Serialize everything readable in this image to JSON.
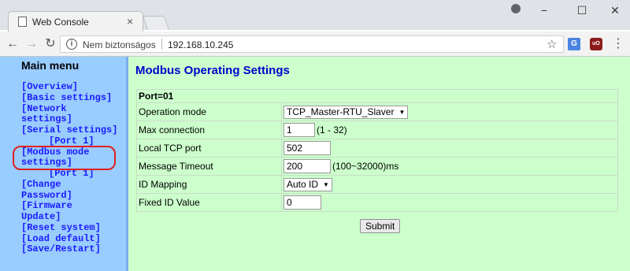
{
  "browser": {
    "tab_title": "Web Console",
    "tab_close": "×",
    "window_controls": [
      "−",
      "☐",
      "✕"
    ],
    "nav": {
      "back": "←",
      "forward": "→",
      "reload": "↻"
    },
    "security_label": "Nem biztonságos",
    "url": "192.168.10.245",
    "extensions": {
      "translate": "G",
      "ublock": "uO"
    },
    "menu": "⋮",
    "star": "☆"
  },
  "sidebar": {
    "title": "Main menu",
    "items": [
      "[Overview]",
      "[Basic settings]",
      "[Network",
      "settings]",
      "[Serial settings]",
      "[Port 1]",
      "[Modbus mode",
      "settings]",
      "[Port 1]",
      "[Change",
      "Password]",
      "[Firmware",
      "Update]",
      "[Reset system]",
      "[Load default]",
      "[Save/Restart]"
    ],
    "highlight_color": "#e02020"
  },
  "main": {
    "title": "Modbus Operating Settings",
    "port_header": "Port=01",
    "rows": {
      "operation_mode": {
        "label": "Operation mode",
        "value": "TCP_Master-RTU_Slaver"
      },
      "max_connection": {
        "label": "Max connection",
        "value": "1",
        "hint": "(1 - 32)"
      },
      "local_tcp_port": {
        "label": "Local TCP port",
        "value": "502"
      },
      "message_timeout": {
        "label": "Message Timeout",
        "value": "200",
        "hint": "(100~32000)ms"
      },
      "id_mapping": {
        "label": "ID Mapping",
        "value": "Auto ID"
      },
      "fixed_id_value": {
        "label": "Fixed ID Value",
        "value": "0"
      }
    },
    "submit_label": "Submit"
  },
  "colors": {
    "sidebar_bg": "#99ccff",
    "main_bg": "#ccffcc",
    "link": "#1a1aff",
    "title": "#0000cc"
  }
}
